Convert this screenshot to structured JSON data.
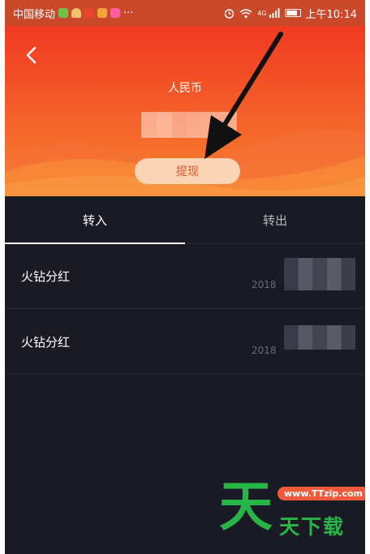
{
  "statusbar": {
    "carrier": "中国移动",
    "more": "···",
    "network": "4G",
    "time": "上午10:14"
  },
  "header": {
    "currency_label": "人民币",
    "withdraw_label": "提现"
  },
  "tabs": [
    {
      "label": "转入",
      "active": true
    },
    {
      "label": "转出",
      "active": false
    }
  ],
  "records": [
    {
      "title": "火钻分红",
      "date": "2018"
    },
    {
      "title": "火钻分红",
      "date": "2018"
    }
  ],
  "watermark": {
    "logo_char": "天",
    "url": "www.TTzip.com",
    "text": "天下载"
  },
  "colors": {
    "header_top": "#f03a22",
    "header_bottom": "#f7832f",
    "background": "#1a1a24",
    "watermark_green": "#28b548"
  }
}
